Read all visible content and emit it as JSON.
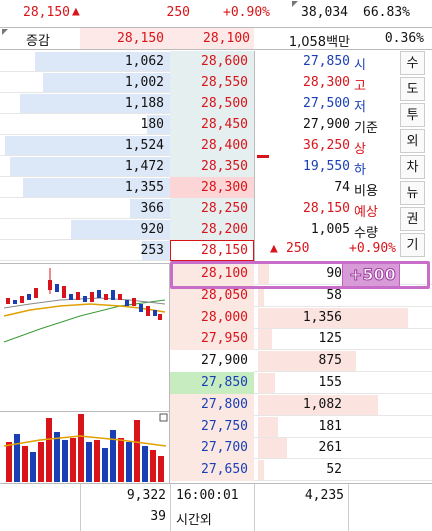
{
  "header": {
    "price": "28,150",
    "change_arrow": "▲",
    "change": "250",
    "change_pct": "+0.90%",
    "volume": "38,034",
    "strength": "66.83%"
  },
  "subheader": {
    "mode_label": "증감",
    "bid_sum": "28,150",
    "ask_price": "28,100",
    "amount": "1,058백만",
    "ratio": "0.36%"
  },
  "ask_rows": [
    {
      "qty": "1,062",
      "price": "28,600",
      "bar": 0.82
    },
    {
      "qty": "1,002",
      "price": "28,550",
      "bar": 0.77
    },
    {
      "qty": "1,188",
      "price": "28,500",
      "bar": 0.91
    },
    {
      "qty": "180",
      "price": "28,450",
      "bar": 0.14
    },
    {
      "qty": "1,524",
      "price": "28,400",
      "bar": 1.0
    },
    {
      "qty": "1,472",
      "price": "28,350",
      "bar": 0.97
    },
    {
      "qty": "1,355",
      "price": "28,300",
      "bar": 0.89
    },
    {
      "qty": "366",
      "price": "28,250",
      "bar": 0.24
    },
    {
      "qty": "920",
      "price": "28,200",
      "bar": 0.6
    },
    {
      "qty": "253",
      "price": "28,150",
      "bar": 0.17
    }
  ],
  "bid_rows": [
    {
      "price": "28,100",
      "qty": "90",
      "bar": 0.07
    },
    {
      "price": "28,050",
      "qty": "58",
      "bar": 0.04
    },
    {
      "price": "28,000",
      "qty": "1,356",
      "bar": 1.0
    },
    {
      "price": "27,950",
      "qty": "125",
      "bar": 0.09
    },
    {
      "price": "27,900",
      "qty": "875",
      "bar": 0.65
    },
    {
      "price": "27,850",
      "qty": "155",
      "bar": 0.11
    },
    {
      "price": "27,800",
      "qty": "1,082",
      "bar": 0.8
    },
    {
      "price": "27,750",
      "qty": "181",
      "bar": 0.13
    },
    {
      "price": "27,700",
      "qty": "261",
      "bar": 0.19
    },
    {
      "price": "27,650",
      "qty": "52",
      "bar": 0.04
    }
  ],
  "info": [
    {
      "value": "27,850",
      "label": "시",
      "color": "#1a3fb5"
    },
    {
      "value": "28,300",
      "label": "고",
      "color": "#d8141a"
    },
    {
      "value": "27,500",
      "label": "저",
      "color": "#1a3fb5"
    },
    {
      "value": "27,900",
      "label": "기준",
      "color": "#111111"
    },
    {
      "value": "36,250",
      "label": "상",
      "color": "#d8141a"
    },
    {
      "value": "19,550",
      "label": "하",
      "color": "#1a3fb5"
    },
    {
      "value": "74",
      "label": "비용",
      "color": "#111111"
    },
    {
      "value": "28,150",
      "label": "예상",
      "color": "#d8141a"
    },
    {
      "value": "1,005",
      "label": "수량",
      "color": "#111111"
    }
  ],
  "expected_change": {
    "arrow": "▲",
    "change": "250",
    "pct": "+0.90%"
  },
  "side_tabs": [
    "수",
    "도",
    "투",
    "외",
    "차",
    "뉴",
    "권",
    "기"
  ],
  "popup": {
    "text": "+500"
  },
  "footer": {
    "ask_total": "9,322",
    "ask_sub": "39",
    "time": "16:00:01",
    "after_hours": "시간외",
    "bid_total": "4,235"
  },
  "colors": {
    "up": "#d8141a",
    "down": "#1a3fb5",
    "ask_bar": "#dce8f8",
    "bid_bar": "#fbe4e0",
    "highlight": "#c060c0"
  }
}
